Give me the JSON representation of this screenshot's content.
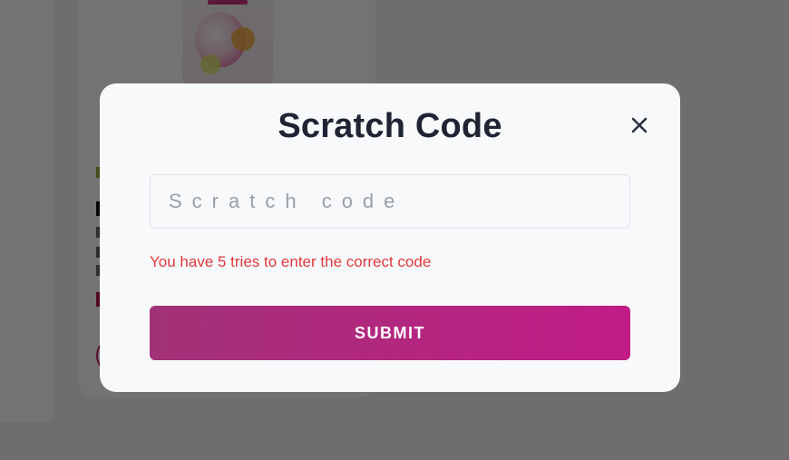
{
  "modal": {
    "title": "Scratch Code",
    "input": {
      "placeholder": "Scratch code",
      "value": ""
    },
    "hint": "You have 5 tries to enter the correct code",
    "submit_label": "SUBMIT",
    "close_icon": "close-icon"
  },
  "colors": {
    "hint_red": "#e0393e",
    "submit_gradient_start": "#a23277",
    "submit_gradient_end": "#c11c86",
    "title": "#1e2433"
  }
}
